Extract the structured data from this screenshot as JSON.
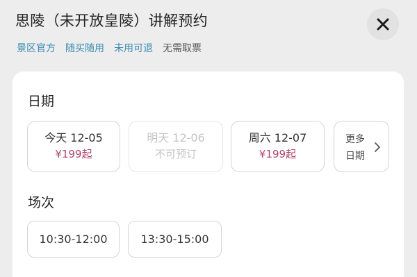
{
  "header": {
    "title": "思陵（未开放皇陵）讲解预约",
    "close_icon": "close-icon"
  },
  "tags": [
    {
      "label": "景区官方",
      "style": "link"
    },
    {
      "label": "随买随用",
      "style": "link"
    },
    {
      "label": "未用可退",
      "style": "link"
    },
    {
      "label": "无需取票",
      "style": "plain"
    }
  ],
  "date_section": {
    "label": "日期",
    "cards": [
      {
        "day": "今天 12-05",
        "status": "¥199起",
        "available": true
      },
      {
        "day": "明天 12-06",
        "status": "不可预订",
        "available": false
      },
      {
        "day": "周六 12-07",
        "status": "¥199起",
        "available": true
      }
    ],
    "more": {
      "line1": "更多",
      "line2": "日期",
      "icon": "chevron-right-icon"
    }
  },
  "session_section": {
    "label": "场次",
    "slots": [
      {
        "time": "10:30-12:00"
      },
      {
        "time": "13:30-15:00"
      }
    ]
  },
  "colors": {
    "price": "#b0466a",
    "tag_link": "#3b8bb2",
    "background": "#ededed",
    "panel": "#ffffff"
  }
}
